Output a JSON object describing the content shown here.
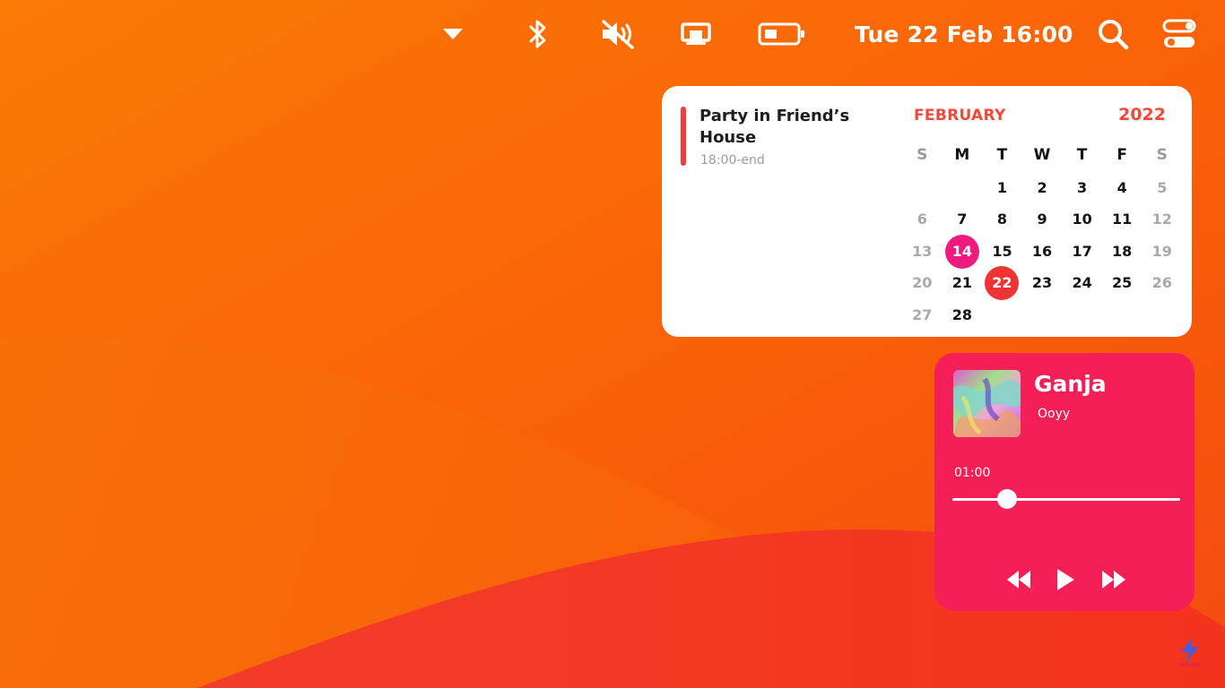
{
  "menubar": {
    "clock": "Tue 22 Feb  16:00",
    "icons": [
      "dropdown-icon",
      "bluetooth-icon",
      "mute-icon",
      "display-icon",
      "battery-icon",
      "search-icon",
      "control-center-icon"
    ]
  },
  "calendar": {
    "event": {
      "title": "Party in Friend’s House",
      "time": "18:00-end"
    },
    "month": "FEBRUARY",
    "year": "2022",
    "weekdays": [
      "S",
      "M",
      "T",
      "W",
      "T",
      "F",
      "S"
    ],
    "weeks": [
      [
        "",
        "",
        "1",
        "2",
        "3",
        "4",
        "5"
      ],
      [
        "6",
        "7",
        "8",
        "9",
        "10",
        "11",
        "12"
      ],
      [
        "13",
        "14",
        "15",
        "16",
        "17",
        "18",
        "19"
      ],
      [
        "20",
        "21",
        "22",
        "23",
        "24",
        "25",
        "26"
      ],
      [
        "27",
        "28",
        "",
        "",
        "",
        "",
        ""
      ]
    ],
    "marked_day": "14",
    "today": "22",
    "colors": {
      "accent": "#ef4a3a",
      "marked": "#f0197e",
      "today": "#ef3434"
    }
  },
  "music": {
    "title": "Ganja",
    "artist": "Ooyy",
    "elapsed": "01:00",
    "progress": 0.24,
    "controls": [
      "rewind-icon",
      "play-icon",
      "fast-forward-icon"
    ],
    "background": "#f41f56"
  }
}
